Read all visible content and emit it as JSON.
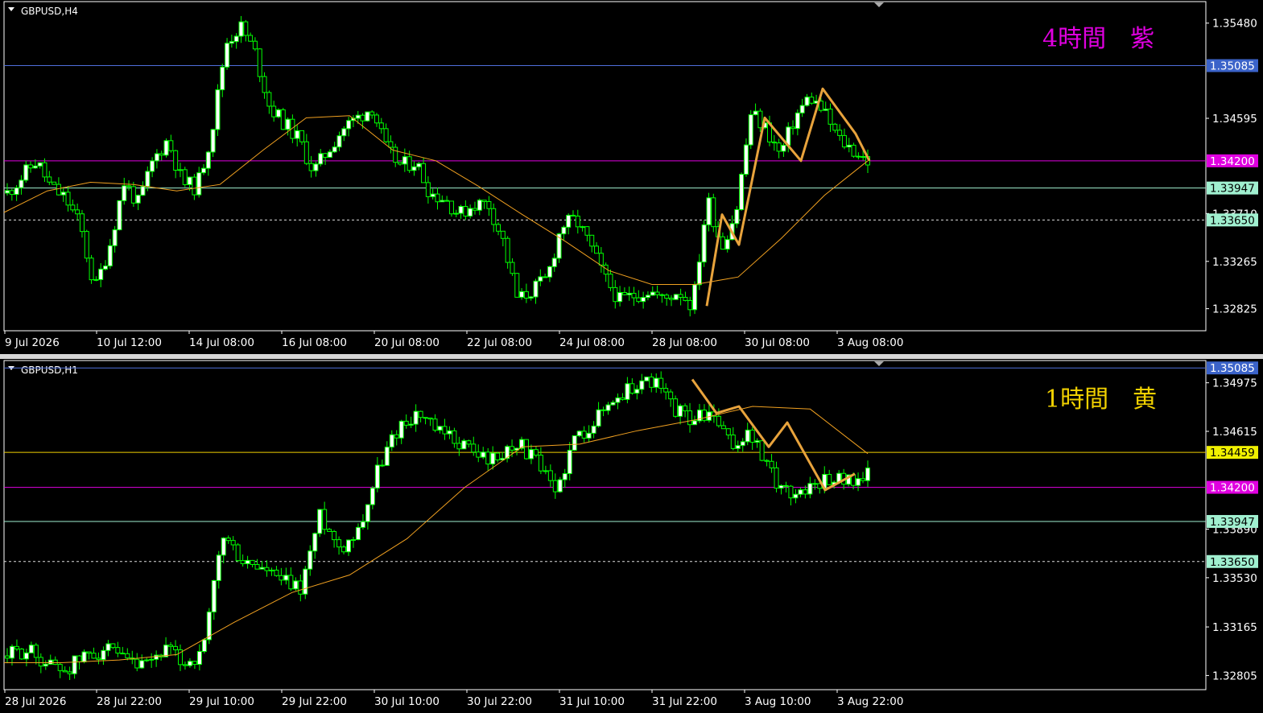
{
  "colors": {
    "background": "#000000",
    "grid_frame": "#ffffff",
    "bull_candle": "#ffffff",
    "bear_candle": "#000000",
    "wick": "#00ff00",
    "ma_line": "#f0a020",
    "zigzag": "#e8a33c",
    "level_blue": "#4f6fdc",
    "level_magenta": "#e000e0",
    "level_green": "#a0f0d0",
    "level_yellow": "#f0d000",
    "level_dotted": "#dddddd"
  },
  "chart_data": [
    {
      "type": "candlestick",
      "symbol_label": "GBPUSD,H4",
      "annotation": "4時間　紫",
      "annotation_color": "#e000e0",
      "ylim": [
        1.3262,
        1.3568
      ],
      "y_ticks": [
        "1.35480",
        "1.34595",
        "1.33710",
        "1.33265",
        "1.32825"
      ],
      "x_ticks": [
        "9 Jul 2026",
        "10 Jul 12:00",
        "14 Jul 08:00",
        "16 Jul 08:00",
        "20 Jul 08:00",
        "22 Jul 08:00",
        "24 Jul 08:00",
        "28 Jul 08:00",
        "30 Jul 08:00",
        "3 Aug 08:00"
      ],
      "levels": [
        {
          "value": 1.35085,
          "label": "1.35085",
          "style": "solid",
          "color": "#4f6fdc",
          "tag_bg": "#3b63c9",
          "tag_fg": "#ffffff"
        },
        {
          "value": 1.342,
          "label": "1.34200",
          "style": "solid",
          "color": "#e000e0",
          "tag_bg": "#e000e0",
          "tag_fg": "#ffffff"
        },
        {
          "value": 1.33947,
          "label": "1.33947",
          "style": "solid",
          "color": "#a0f0d0",
          "tag_bg": "#a0f0d0",
          "tag_fg": "#000000"
        },
        {
          "value": 1.3365,
          "label": "1.33650",
          "style": "dotted",
          "color": "#dddddd",
          "tag_bg": "#a0f0d0",
          "tag_fg": "#000000"
        }
      ],
      "anchors": [
        1.339,
        1.3405,
        1.342,
        1.3395,
        1.3385,
        1.336,
        1.33,
        1.334,
        1.34,
        1.338,
        1.342,
        1.344,
        1.34,
        1.3395,
        1.3445,
        1.353,
        1.3545,
        1.352,
        1.347,
        1.3455,
        1.344,
        1.341,
        1.343,
        1.345,
        1.346,
        1.347,
        1.343,
        1.3415,
        1.342,
        1.339,
        1.3385,
        1.337,
        1.338,
        1.338,
        1.3345,
        1.329,
        1.33,
        1.331,
        1.336,
        1.3365,
        1.334,
        1.331,
        1.329,
        1.3295,
        1.33,
        1.329,
        1.33,
        1.3285,
        1.3385,
        1.334,
        1.3375,
        1.3465,
        1.345,
        1.3425,
        1.346,
        1.348,
        1.3465,
        1.344,
        1.343,
        1.342
      ],
      "ma": [
        1.3372,
        1.3392,
        1.34,
        1.3398,
        1.3392,
        1.3398,
        1.343,
        1.346,
        1.3462,
        1.343,
        1.342,
        1.3396,
        1.337,
        1.3345,
        1.3318,
        1.3305,
        1.3305,
        1.3312,
        1.3348,
        1.3388,
        1.342
      ],
      "zigzag": [
        1.3285,
        1.337,
        1.3342,
        1.346,
        1.342,
        1.3487,
        1.3445,
        1.342
      ]
    },
    {
      "type": "candlestick",
      "symbol_label": "GBPUSD,H1",
      "annotation": "1時間　黄",
      "annotation_color": "#f0d000",
      "ylim": [
        1.327,
        1.3514
      ],
      "y_ticks": [
        "1.34975",
        "1.34615",
        "1.33890",
        "1.33530",
        "1.33165",
        "1.32805"
      ],
      "x_ticks": [
        "28 Jul 2026",
        "28 Jul 22:00",
        "29 Jul 10:00",
        "29 Jul 22:00",
        "30 Jul 10:00",
        "30 Jul 22:00",
        "31 Jul 10:00",
        "31 Jul 22:00",
        "3 Aug 10:00",
        "3 Aug 22:00"
      ],
      "levels": [
        {
          "value": 1.35085,
          "label": "1.35085",
          "style": "solid",
          "color": "#4f6fdc",
          "tag_bg": "#3b63c9",
          "tag_fg": "#ffffff"
        },
        {
          "value": 1.34459,
          "label": "1.34459",
          "style": "solid",
          "color": "#f0d000",
          "tag_bg": "#f0f000",
          "tag_fg": "#000000"
        },
        {
          "value": 1.342,
          "label": "1.34200",
          "style": "solid",
          "color": "#e000e0",
          "tag_bg": "#e000e0",
          "tag_fg": "#ffffff"
        },
        {
          "value": 1.33947,
          "label": "1.33947",
          "style": "solid",
          "color": "#a0f0d0",
          "tag_bg": "#a0f0d0",
          "tag_fg": "#000000"
        },
        {
          "value": 1.3365,
          "label": "1.33650",
          "style": "dotted",
          "color": "#dddddd",
          "tag_bg": "#a0f0d0",
          "tag_fg": "#000000"
        }
      ],
      "anchors": [
        1.3295,
        1.33,
        1.329,
        1.3285,
        1.3295,
        1.33,
        1.329,
        1.3285,
        1.33,
        1.329,
        1.3295,
        1.3385,
        1.3365,
        1.336,
        1.335,
        1.3345,
        1.34,
        1.3375,
        1.339,
        1.3435,
        1.3465,
        1.3475,
        1.346,
        1.3455,
        1.3445,
        1.344,
        1.3455,
        1.344,
        1.3415,
        1.3455,
        1.347,
        1.3485,
        1.3495,
        1.35,
        1.348,
        1.347,
        1.3475,
        1.345,
        1.346,
        1.343,
        1.3415,
        1.342,
        1.3428,
        1.3425,
        1.343
      ],
      "ma": [
        1.329,
        1.329,
        1.3292,
        1.3296,
        1.332,
        1.3342,
        1.3355,
        1.3382,
        1.342,
        1.345,
        1.3452,
        1.3462,
        1.347,
        1.348,
        1.3478,
        1.3445
      ],
      "zigzag": [
        1.35,
        1.3475,
        1.348,
        1.345,
        1.3468,
        1.3418,
        1.343
      ]
    }
  ]
}
